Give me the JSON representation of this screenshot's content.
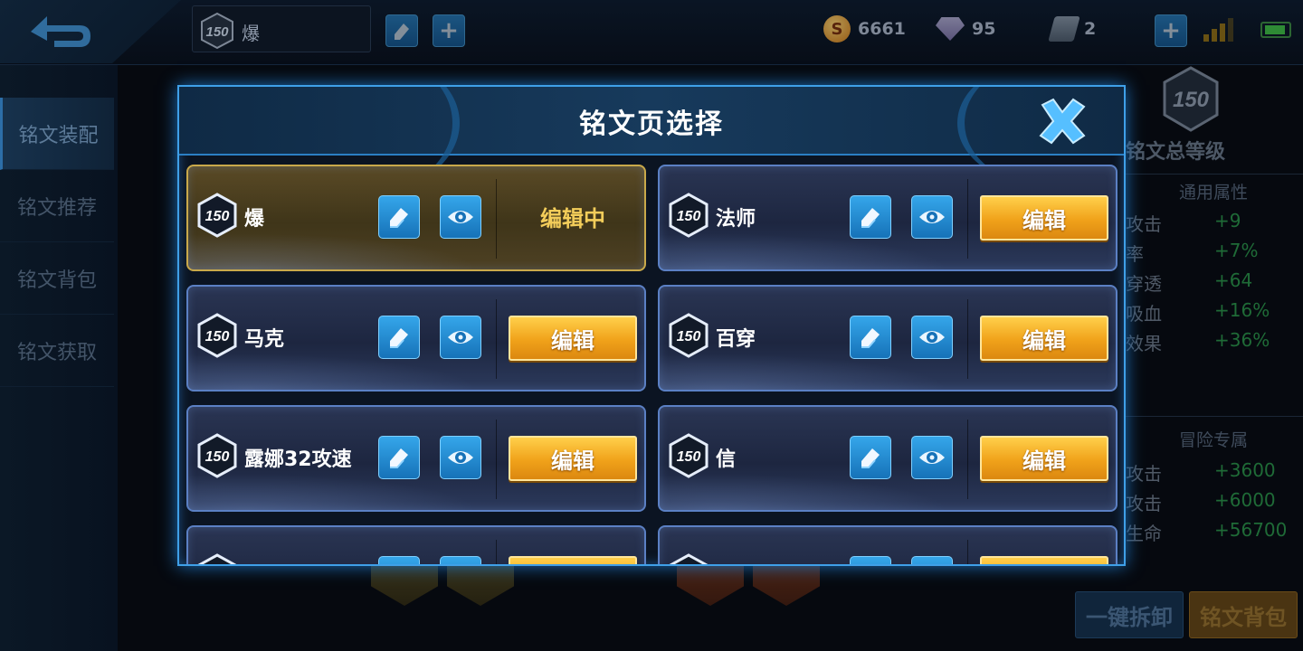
{
  "topbar": {
    "current_page": {
      "level": "150",
      "name": "爆"
    },
    "currencies": [
      {
        "icon": "gold-coin-icon",
        "value": "6661"
      },
      {
        "icon": "diamond-icon",
        "value": "95"
      },
      {
        "icon": "ticket-icon",
        "value": "2"
      }
    ]
  },
  "sidebar": {
    "items": [
      {
        "label": "铭文装配",
        "active": true
      },
      {
        "label": "铭文推荐"
      },
      {
        "label": "铭文背包"
      },
      {
        "label": "铭文获取"
      }
    ]
  },
  "right_panel": {
    "level": "150",
    "title": "铭文总等级",
    "general_title": "通用属性",
    "general_stats": [
      {
        "key": "攻击",
        "value": "+9"
      },
      {
        "key": "率",
        "value": "+7%"
      },
      {
        "key": "穿透",
        "value": "+64"
      },
      {
        "key": "吸血",
        "value": "+16%"
      },
      {
        "key": "效果",
        "value": "+36%"
      }
    ],
    "adventure_title": "冒险专属",
    "adventure_stats": [
      {
        "key": "攻击",
        "value": "+3600"
      },
      {
        "key": "攻击",
        "value": "+6000"
      },
      {
        "key": "生命",
        "value": "+56700"
      }
    ],
    "unequip_all_label": "一键拆卸",
    "bag_label": "铭文背包"
  },
  "modal": {
    "title": "铭文页选择",
    "edit_label": "编辑",
    "editing_label": "编辑中",
    "pages": [
      {
        "level": "150",
        "name": "爆",
        "editing": true
      },
      {
        "level": "150",
        "name": "法师"
      },
      {
        "level": "150",
        "name": "马克"
      },
      {
        "level": "150",
        "name": "百穿"
      },
      {
        "level": "150",
        "name": "露娜32攻速"
      },
      {
        "level": "150",
        "name": "信"
      },
      {
        "level": "",
        "name": ""
      },
      {
        "level": "",
        "name": ""
      }
    ]
  },
  "colors": {
    "accent_blue": "#3fa0e8",
    "edit_orange": "#f0a21a",
    "editing_gold": "#c9a94a",
    "stat_green": "#1f6b37"
  }
}
